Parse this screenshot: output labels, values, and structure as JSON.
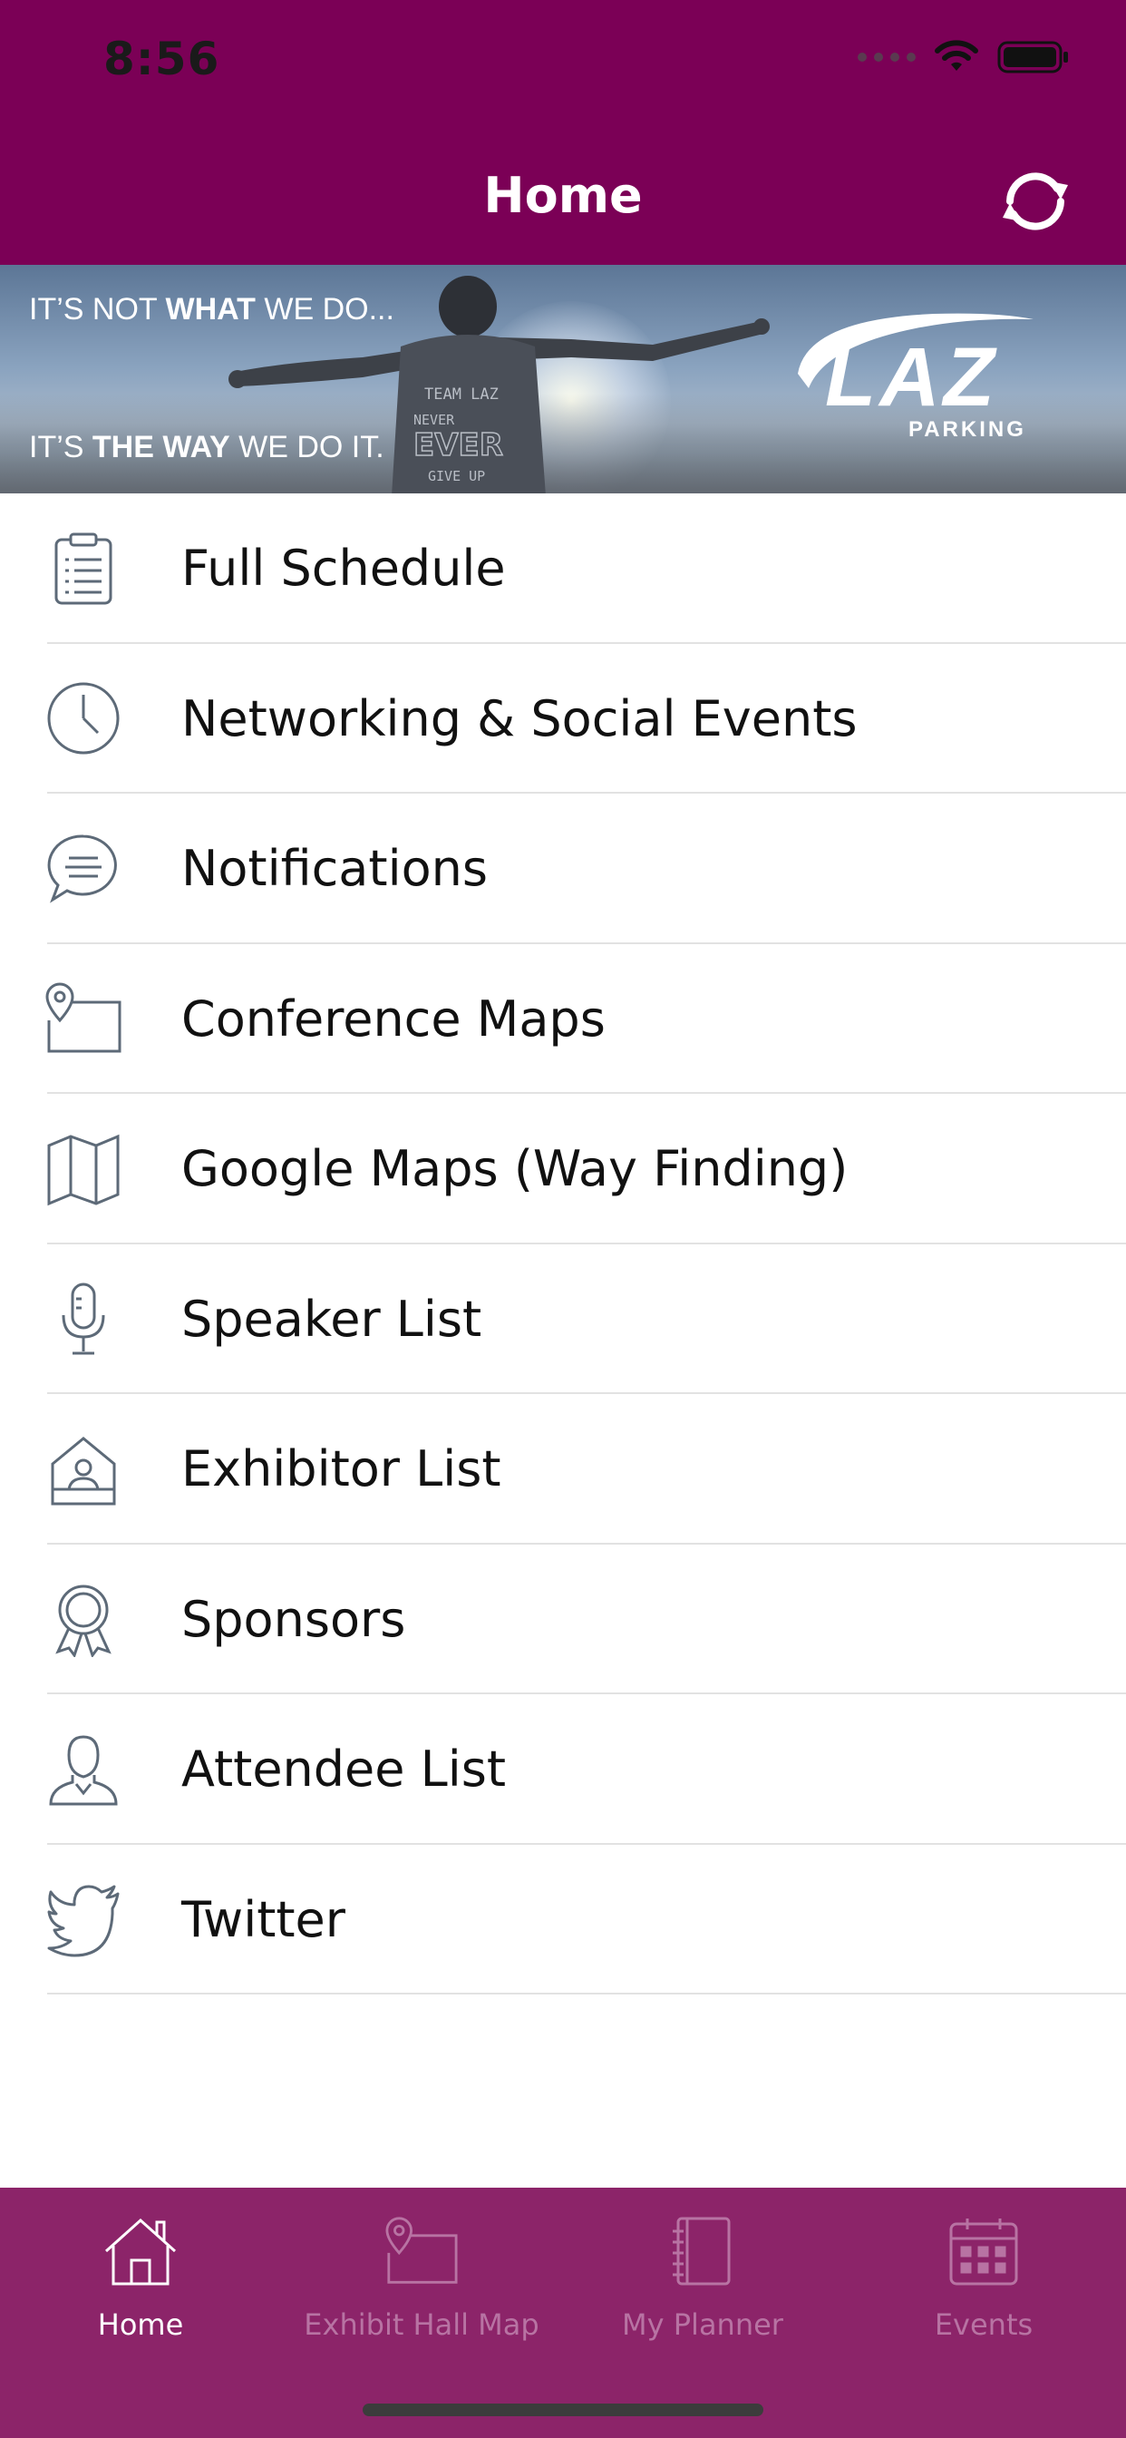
{
  "status_bar": {
    "time": "8:56"
  },
  "nav": {
    "title": "Home",
    "refresh_icon": "refresh-icon"
  },
  "banner": {
    "top_prefix": "IT’S NOT ",
    "top_bold": "WHAT",
    "top_suffix": " WE DO...",
    "bottom_prefix": "IT’S ",
    "bottom_bold": "THE WAY",
    "bottom_suffix": " WE DO IT.",
    "shirt_text": "TEAM LAZ NEVER EVER GIVE UP",
    "logo_text": "LAZ",
    "logo_subtext": "PARKING"
  },
  "menu": {
    "items": [
      {
        "label": "Full Schedule",
        "icon": "clipboard-list-icon"
      },
      {
        "label": "Networking & Social Events",
        "icon": "clock-icon"
      },
      {
        "label": "Notifications",
        "icon": "chat-bubble-icon"
      },
      {
        "label": "Conference Maps",
        "icon": "map-pin-card-icon"
      },
      {
        "label": "Google Maps (Way Finding)",
        "icon": "folded-map-icon"
      },
      {
        "label": "Speaker List",
        "icon": "microphone-icon"
      },
      {
        "label": "Exhibitor List",
        "icon": "exhibitor-booth-icon"
      },
      {
        "label": "Sponsors",
        "icon": "award-ribbon-icon"
      },
      {
        "label": "Attendee List",
        "icon": "person-icon"
      },
      {
        "label": "Twitter",
        "icon": "twitter-bird-icon"
      }
    ]
  },
  "tabbar": {
    "tabs": [
      {
        "label": "Home",
        "icon": "home-icon",
        "active": true
      },
      {
        "label": "Exhibit Hall Map",
        "icon": "map-pin-card-icon",
        "active": false
      },
      {
        "label": "My Planner",
        "icon": "notebook-icon",
        "active": false
      },
      {
        "label": "Events",
        "icon": "calendar-icon",
        "active": false
      }
    ]
  },
  "colors": {
    "nav_background": "#7b0056",
    "tabbar_background": "#8c2469",
    "tab_active": "#ffffff",
    "tab_inactive": "#b873a3",
    "icon_stroke": "#5d6a78"
  }
}
